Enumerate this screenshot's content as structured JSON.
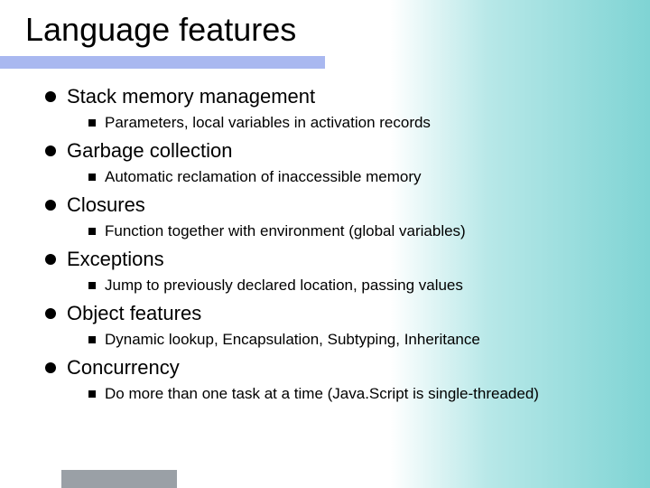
{
  "title": "Language features",
  "items": [
    {
      "label": "Stack memory management",
      "sub": "Parameters, local variables in activation records"
    },
    {
      "label": "Garbage collection",
      "sub": "Automatic reclamation of inaccessible memory"
    },
    {
      "label": "Closures",
      "sub": "Function together with environment (global variables)"
    },
    {
      "label": "Exceptions",
      "sub": "Jump to previously declared location, passing values"
    },
    {
      "label": "Object features",
      "sub": "Dynamic lookup, Encapsulation, Subtyping, Inheritance"
    },
    {
      "label": "Concurrency",
      "sub": "Do more than one task at a time (Java.Script is single-threaded)"
    }
  ]
}
